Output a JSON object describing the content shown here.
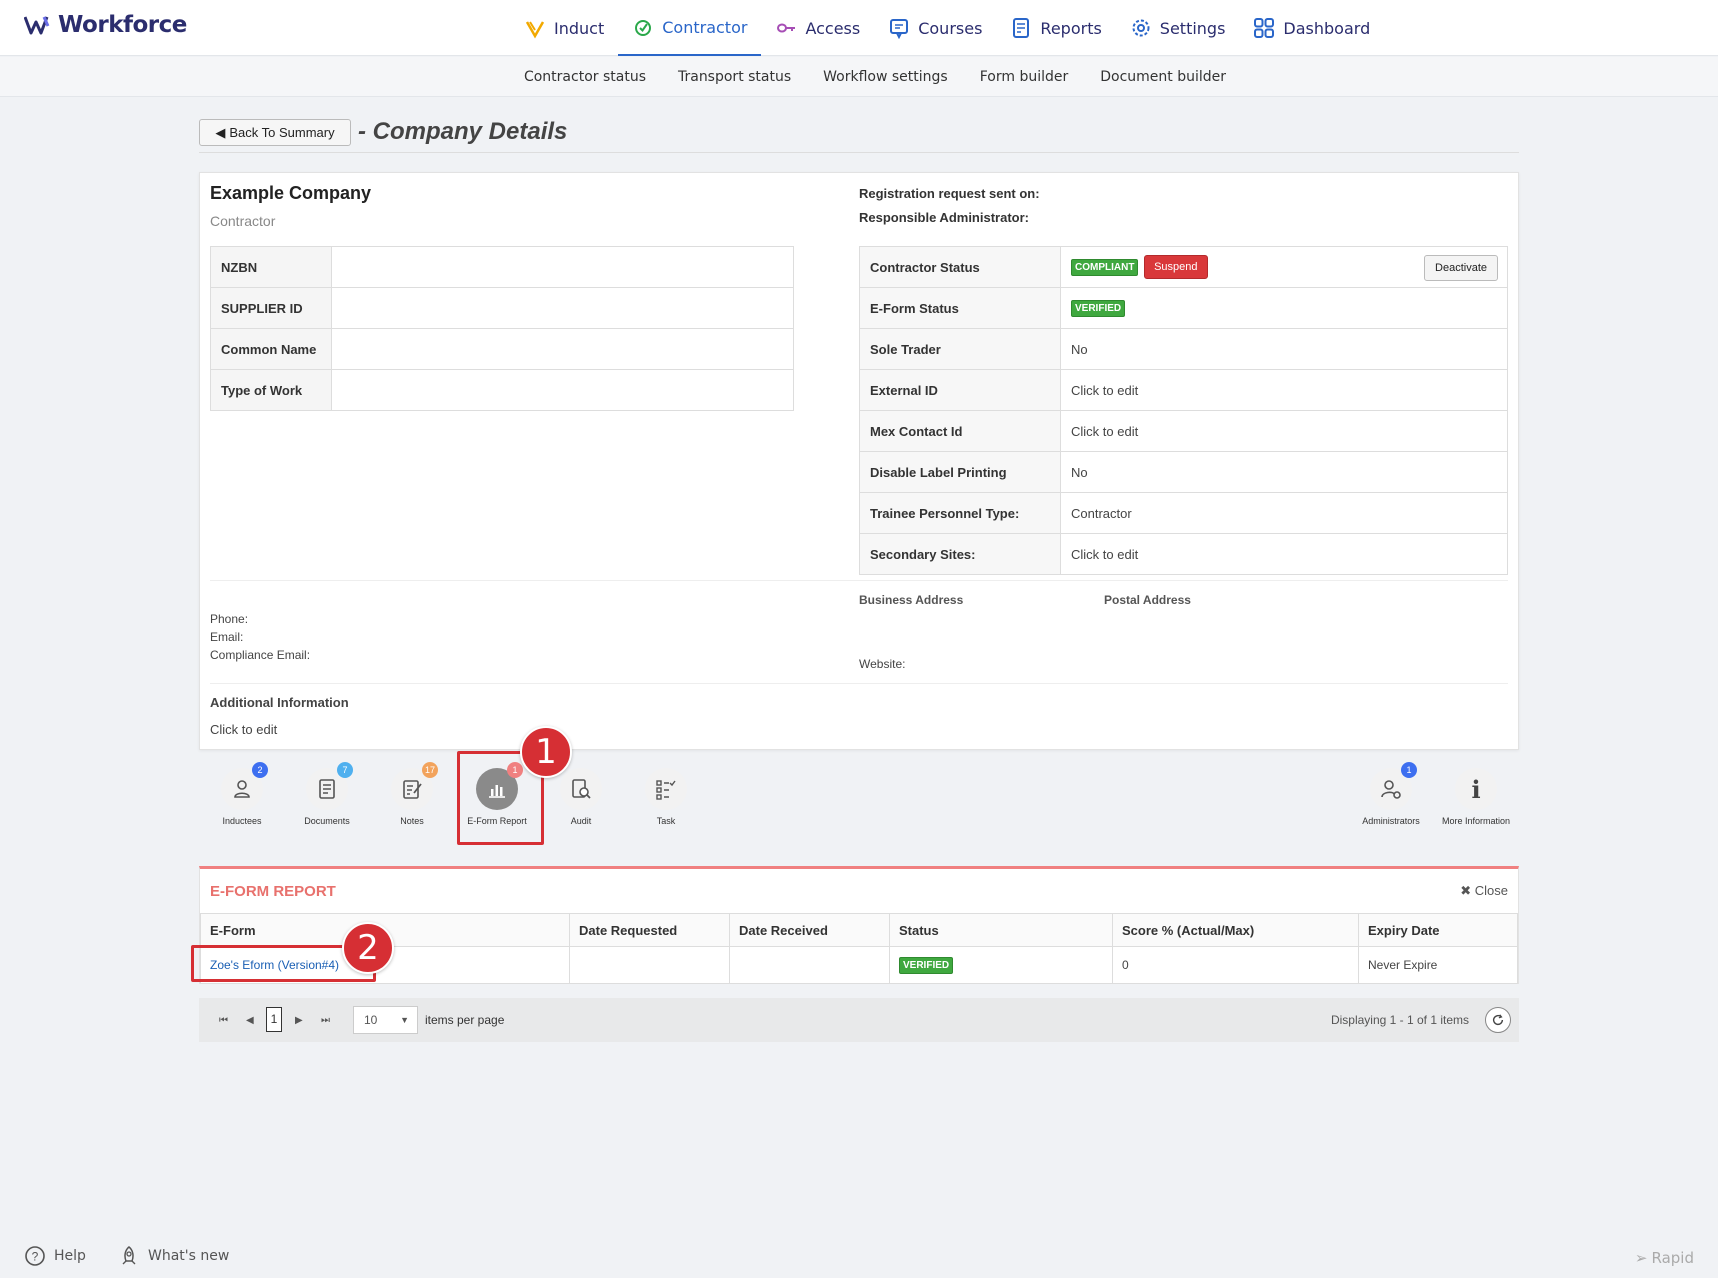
{
  "brand": {
    "name": "Workforce"
  },
  "nav": {
    "items": [
      {
        "label": "Induct",
        "icon": "induct-icon",
        "color": "#f2a900"
      },
      {
        "label": "Contractor",
        "icon": "contractor-icon",
        "color": "#2aa84a",
        "active": true
      },
      {
        "label": "Access",
        "icon": "access-key-icon",
        "color": "#a64db5"
      },
      {
        "label": "Courses",
        "icon": "courses-icon",
        "color": "#2a66c9"
      },
      {
        "label": "Reports",
        "icon": "reports-icon",
        "color": "#2a66c9"
      },
      {
        "label": "Settings",
        "icon": "gear-icon",
        "color": "#2a66c9"
      },
      {
        "label": "Dashboard",
        "icon": "dashboard-icon",
        "color": "#2a66c9"
      }
    ]
  },
  "subnav": [
    "Contractor status",
    "Transport status",
    "Workflow settings",
    "Form builder",
    "Document builder"
  ],
  "header": {
    "back_label": "Back To Summary",
    "title": "- Company Details"
  },
  "company": {
    "name": "Example Company",
    "type": "Contractor",
    "fields": [
      {
        "label": "NZBN",
        "value": ""
      },
      {
        "label": "SUPPLIER ID",
        "value": ""
      },
      {
        "label": "Common Name",
        "value": ""
      },
      {
        "label": "Type of Work",
        "value": ""
      }
    ],
    "registration_label": "Registration request sent on:",
    "admin_label": "Responsible Administrator:"
  },
  "status_table": {
    "contractor_status_label": "Contractor Status",
    "compliant_badge": "COMPLIANT",
    "suspend_label": "Suspend",
    "deactivate_label": "Deactivate",
    "eform_status_label": "E-Form Status",
    "verified_badge": "VERIFIED",
    "rows": [
      {
        "label": "Sole Trader",
        "value": "No"
      },
      {
        "label": "External ID",
        "value": "Click to edit"
      },
      {
        "label": "Mex Contact Id",
        "value": "Click to edit"
      },
      {
        "label": "Disable Label Printing",
        "value": "No"
      },
      {
        "label": "Trainee Personnel Type:",
        "value": "Contractor"
      },
      {
        "label": "Secondary Sites:",
        "value": "Click to edit"
      }
    ]
  },
  "contact": {
    "phone_label": "Phone:",
    "email_label": "Email:",
    "compliance_label": "Compliance Email:",
    "business_address_label": "Business Address",
    "postal_address_label": "Postal Address",
    "website_label": "Website:",
    "additional_info_label": "Additional Information",
    "additional_info_value": "Click to edit"
  },
  "toolbar": {
    "tools": [
      {
        "label": "Inductees",
        "count": "2",
        "count_color": "#3d6ff0"
      },
      {
        "label": "Documents",
        "count": "7",
        "count_color": "#4fb0ef"
      },
      {
        "label": "Notes",
        "count": "17",
        "count_color": "#f2a35c"
      },
      {
        "label": "E-Form Report",
        "count": "1",
        "count_color": "#f08080"
      },
      {
        "label": "Audit",
        "count": ""
      },
      {
        "label": "Task",
        "count": ""
      },
      {
        "label": "Administrators",
        "count": "1",
        "count_color": "#3d6ff0"
      },
      {
        "label": "More Information",
        "count": ""
      }
    ]
  },
  "markers": [
    "1",
    "2"
  ],
  "eform_report": {
    "title": "E-FORM REPORT",
    "close_label": "Close",
    "columns": [
      "E-Form",
      "Date Requested",
      "Date Received",
      "Status",
      "Score % (Actual/Max)",
      "Expiry Date"
    ],
    "rows": [
      {
        "eform": "Zoe's Eform (Version#4)",
        "requested": "",
        "received": "",
        "status": "VERIFIED",
        "score": "0",
        "expiry": "Never Expire"
      }
    ]
  },
  "pager": {
    "page": "1",
    "page_size": "10",
    "items_per_page_label": "items per page",
    "display_text": "Displaying 1 - 1 of 1 items"
  },
  "footer": {
    "help_label": "Help",
    "whats_new_label": "What's new",
    "rapid_label": "Rapid"
  }
}
